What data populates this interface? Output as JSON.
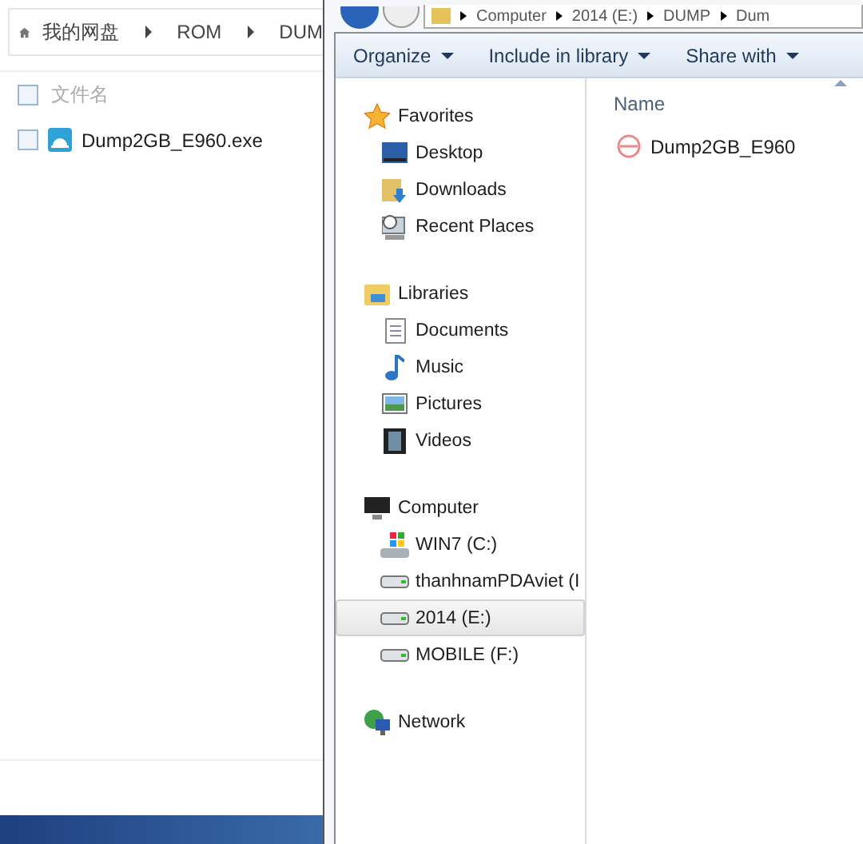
{
  "left_window": {
    "breadcrumb": [
      "我的网盘",
      "ROM",
      "DUM"
    ],
    "list_header": {
      "label": "文件名",
      "checked": false
    },
    "files": [
      {
        "name": "Dump2GB_E960.exe",
        "checked": false
      }
    ]
  },
  "explorer": {
    "address": [
      "Computer",
      "2014 (E:)",
      "DUMP",
      "Dum"
    ],
    "toolbar": [
      "Organize",
      "Include in library",
      "Share with"
    ],
    "nav": [
      {
        "label": "Favorites",
        "kind": "star",
        "selected": false,
        "children": [
          {
            "label": "Desktop",
            "kind": "desktop",
            "selected": false
          },
          {
            "label": "Downloads",
            "kind": "downloads",
            "selected": false
          },
          {
            "label": "Recent Places",
            "kind": "recent",
            "selected": false
          }
        ]
      },
      {
        "label": "Libraries",
        "kind": "library",
        "selected": false,
        "children": [
          {
            "label": "Documents",
            "kind": "document",
            "selected": false
          },
          {
            "label": "Music",
            "kind": "music",
            "selected": false
          },
          {
            "label": "Pictures",
            "kind": "pictures",
            "selected": false
          },
          {
            "label": "Videos",
            "kind": "videos",
            "selected": false
          }
        ]
      },
      {
        "label": "Computer",
        "kind": "computer",
        "selected": false,
        "children": [
          {
            "label": "WIN7 (C:)",
            "kind": "system-drive",
            "selected": false
          },
          {
            "label": "thanhnamPDAviet (I",
            "kind": "drive",
            "selected": false
          },
          {
            "label": "2014 (E:)",
            "kind": "drive",
            "selected": true
          },
          {
            "label": "MOBILE (F:)",
            "kind": "drive",
            "selected": false
          }
        ]
      },
      {
        "label": "Network",
        "kind": "network",
        "selected": false
      }
    ],
    "column": "Name",
    "files": [
      "Dump2GB_E960"
    ]
  }
}
